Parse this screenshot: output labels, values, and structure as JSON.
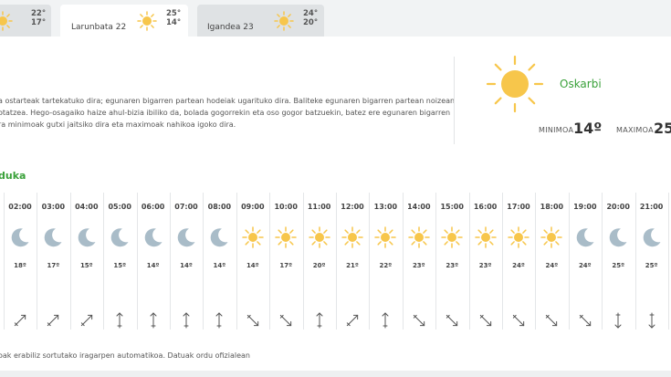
{
  "colors": {
    "accent": "#3aa13a",
    "sun": "#f7c64b",
    "moon": "#a9bcc8",
    "wind": "#555555"
  },
  "day_tabs": [
    {
      "label": "",
      "max": "22°",
      "min": "17°",
      "icon": "sun-icon",
      "active": false
    },
    {
      "label": "Larunbata 22",
      "max": "25°",
      "min": "14°",
      "icon": "sun-icon",
      "active": true
    },
    {
      "label": "Igandea 23",
      "max": "24°",
      "min": "20°",
      "icon": "sun-icon",
      "active": false
    }
  ],
  "forecast": {
    "lines": [
      "a ostarteak tartekatuko dira; egunaren bigarren partean hodeiak ugarituko dira. Baliteke egunaren bigarren partean noizean",
      "otatzea. Hego-osagaiko haize ahul-bizia ibiliko da, bolada gogorrekin eta oso gogor batzuekin, batez ere egunaren bigarren",
      "ra minimoak gutxi jaitsiko dira eta maximoak nahikoa igoko dira."
    ]
  },
  "summary": {
    "condition": "Oskarbi",
    "icon": "sun-icon",
    "min_label": "MINIMOA",
    "min_value": "14º",
    "max_label": "MAXIMOA",
    "max_value": "25"
  },
  "section_title": "duka",
  "hourly": [
    {
      "time": "02:00",
      "icon": "moon-icon",
      "temp": "18º",
      "wind_deg": 45
    },
    {
      "time": "03:00",
      "icon": "moon-icon",
      "temp": "17º",
      "wind_deg": 45
    },
    {
      "time": "04:00",
      "icon": "moon-icon",
      "temp": "15º",
      "wind_deg": 45
    },
    {
      "time": "05:00",
      "icon": "moon-icon",
      "temp": "15º",
      "wind_deg": 0
    },
    {
      "time": "06:00",
      "icon": "moon-icon",
      "temp": "14º",
      "wind_deg": 0
    },
    {
      "time": "07:00",
      "icon": "moon-icon",
      "temp": "14º",
      "wind_deg": 0
    },
    {
      "time": "08:00",
      "icon": "moon-icon",
      "temp": "14º",
      "wind_deg": 0
    },
    {
      "time": "09:00",
      "icon": "sun-icon",
      "temp": "14º",
      "wind_deg": 135
    },
    {
      "time": "10:00",
      "icon": "sun-icon",
      "temp": "17º",
      "wind_deg": 135
    },
    {
      "time": "11:00",
      "icon": "sun-icon",
      "temp": "20º",
      "wind_deg": 0
    },
    {
      "time": "12:00",
      "icon": "sun-icon",
      "temp": "21º",
      "wind_deg": 45
    },
    {
      "time": "13:00",
      "icon": "sun-icon",
      "temp": "22º",
      "wind_deg": 0
    },
    {
      "time": "14:00",
      "icon": "sun-icon",
      "temp": "23º",
      "wind_deg": 135
    },
    {
      "time": "15:00",
      "icon": "sun-icon",
      "temp": "23º",
      "wind_deg": 135
    },
    {
      "time": "16:00",
      "icon": "sun-icon",
      "temp": "23º",
      "wind_deg": 135
    },
    {
      "time": "17:00",
      "icon": "sun-icon",
      "temp": "24º",
      "wind_deg": 135
    },
    {
      "time": "18:00",
      "icon": "sun-icon",
      "temp": "24º",
      "wind_deg": 135
    },
    {
      "time": "19:00",
      "icon": "moon-icon",
      "temp": "24º",
      "wind_deg": 135
    },
    {
      "time": "20:00",
      "icon": "moon-icon",
      "temp": "25º",
      "wind_deg": 180
    },
    {
      "time": "21:00",
      "icon": "moon-icon",
      "temp": "25º",
      "wind_deg": 180
    }
  ],
  "footnote": "oak erabiliz sortutako iragarpen automatikoa. Datuak ordu ofizialean"
}
